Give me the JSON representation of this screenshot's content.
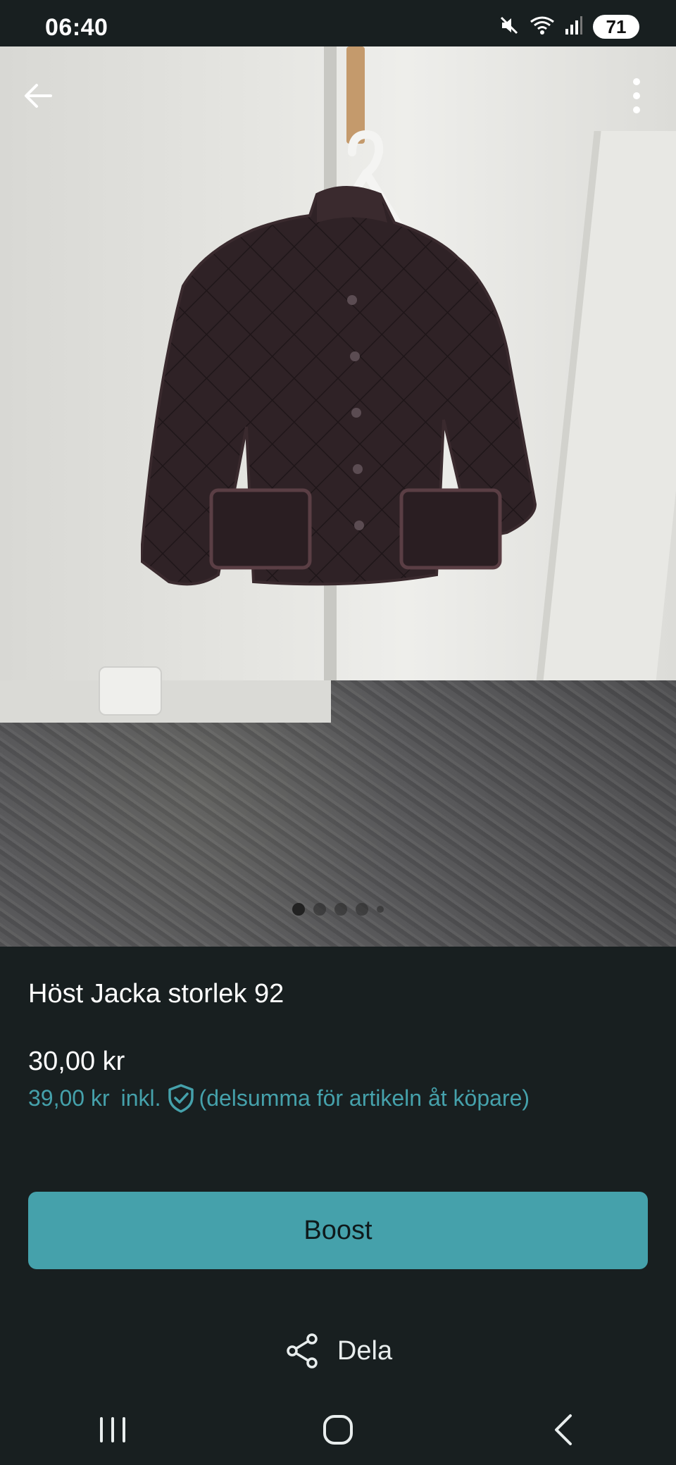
{
  "status_bar": {
    "time": "06:40",
    "battery": "71",
    "icons": [
      "mute-icon",
      "wifi-icon",
      "signal-icon",
      "battery-icon"
    ]
  },
  "photo": {
    "current_index": 1,
    "dot_count": 5,
    "alt": "Höst Jacka storlek 92"
  },
  "listing": {
    "title": "Höst Jacka storlek 92",
    "price": "30,00 kr",
    "price_incl_amount": "39,00 kr",
    "price_incl_label": "inkl.",
    "price_incl_note": "(delsumma för artikeln åt köpare)"
  },
  "actions": {
    "boost_label": "Boost",
    "share_label": "Dela"
  },
  "colors": {
    "accent": "#45a1ab",
    "background": "#181f20"
  }
}
